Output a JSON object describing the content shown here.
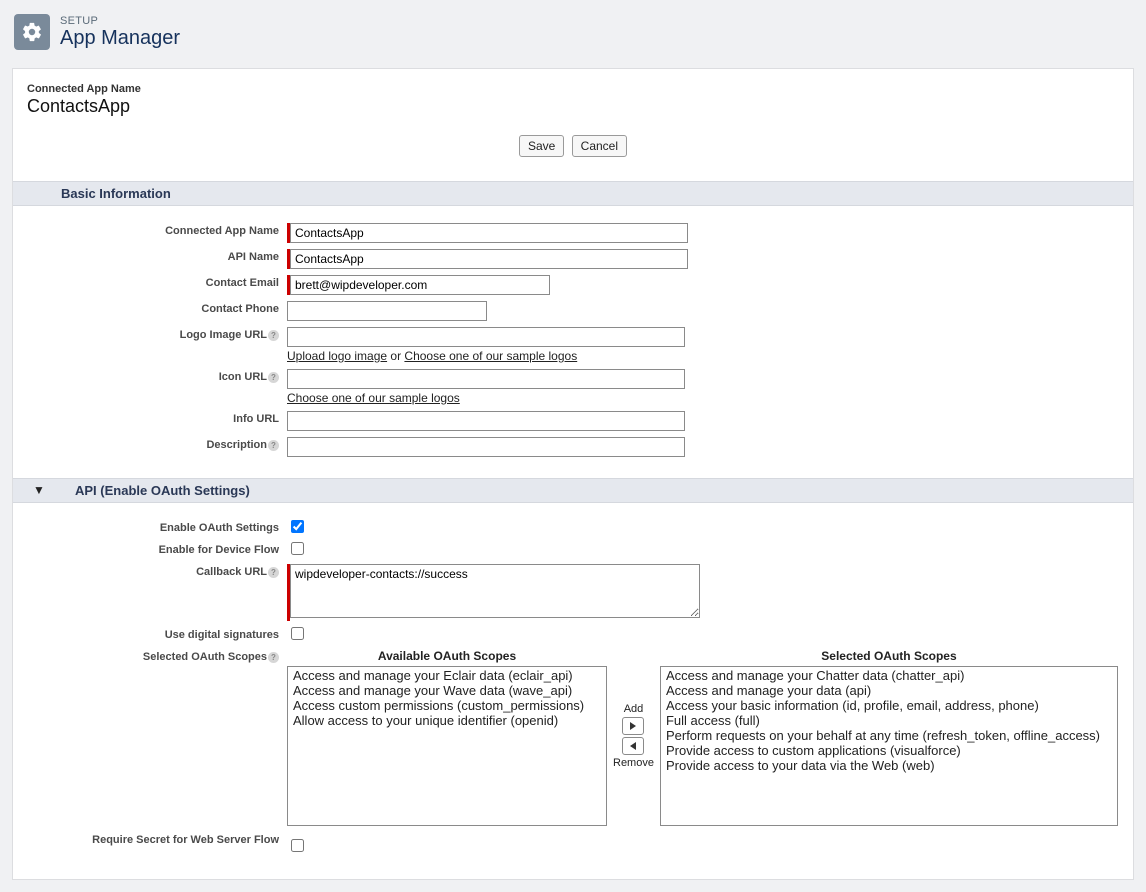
{
  "header": {
    "kicker": "SETUP",
    "title": "App Manager"
  },
  "appNameLabel": "Connected App Name",
  "appNameValue": "ContactsApp",
  "buttons": {
    "save": "Save",
    "cancel": "Cancel"
  },
  "sections": {
    "basic": "Basic Information",
    "api": "API (Enable OAuth Settings)"
  },
  "labels": {
    "connectedAppName": "Connected App Name",
    "apiName": "API Name",
    "contactEmail": "Contact Email",
    "contactPhone": "Contact Phone",
    "logoImageUrl": "Logo Image URL",
    "iconUrl": "Icon URL",
    "infoUrl": "Info URL",
    "description": "Description",
    "enableOauth": "Enable OAuth Settings",
    "enableDeviceFlow": "Enable for Device Flow",
    "callbackUrl": "Callback URL",
    "useDigitalSignatures": "Use digital signatures",
    "selectedOauthScopes": "Selected OAuth Scopes",
    "requireSecret": "Require Secret for Web Server Flow"
  },
  "values": {
    "connectedAppName": "ContactsApp",
    "apiName": "ContactsApp",
    "contactEmail": "brett@wipdeveloper.com",
    "contactPhone": "",
    "logoImageUrl": "",
    "iconUrl": "",
    "infoUrl": "",
    "description": "",
    "enableOauth": true,
    "enableDeviceFlow": false,
    "callbackUrl": "wipdeveloper-contacts://success",
    "useDigitalSignatures": false
  },
  "logoLinks": {
    "upload": "Upload logo image",
    "or": " or ",
    "choose": "Choose one of our sample logos"
  },
  "iconLinks": {
    "choose": "Choose one of our sample logos"
  },
  "scopes": {
    "availableTitle": "Available OAuth Scopes",
    "selectedTitle": "Selected OAuth Scopes",
    "add": "Add",
    "remove": "Remove",
    "available": [
      "Access and manage your Eclair data (eclair_api)",
      "Access and manage your Wave data (wave_api)",
      "Access custom permissions (custom_permissions)",
      "Allow access to your unique identifier (openid)"
    ],
    "selected": [
      "Access and manage your Chatter data (chatter_api)",
      "Access and manage your data (api)",
      "Access your basic information (id, profile, email, address, phone)",
      "Full access (full)",
      "Perform requests on your behalf at any time (refresh_token, offline_access)",
      "Provide access to custom applications (visualforce)",
      "Provide access to your data via the Web (web)"
    ]
  }
}
